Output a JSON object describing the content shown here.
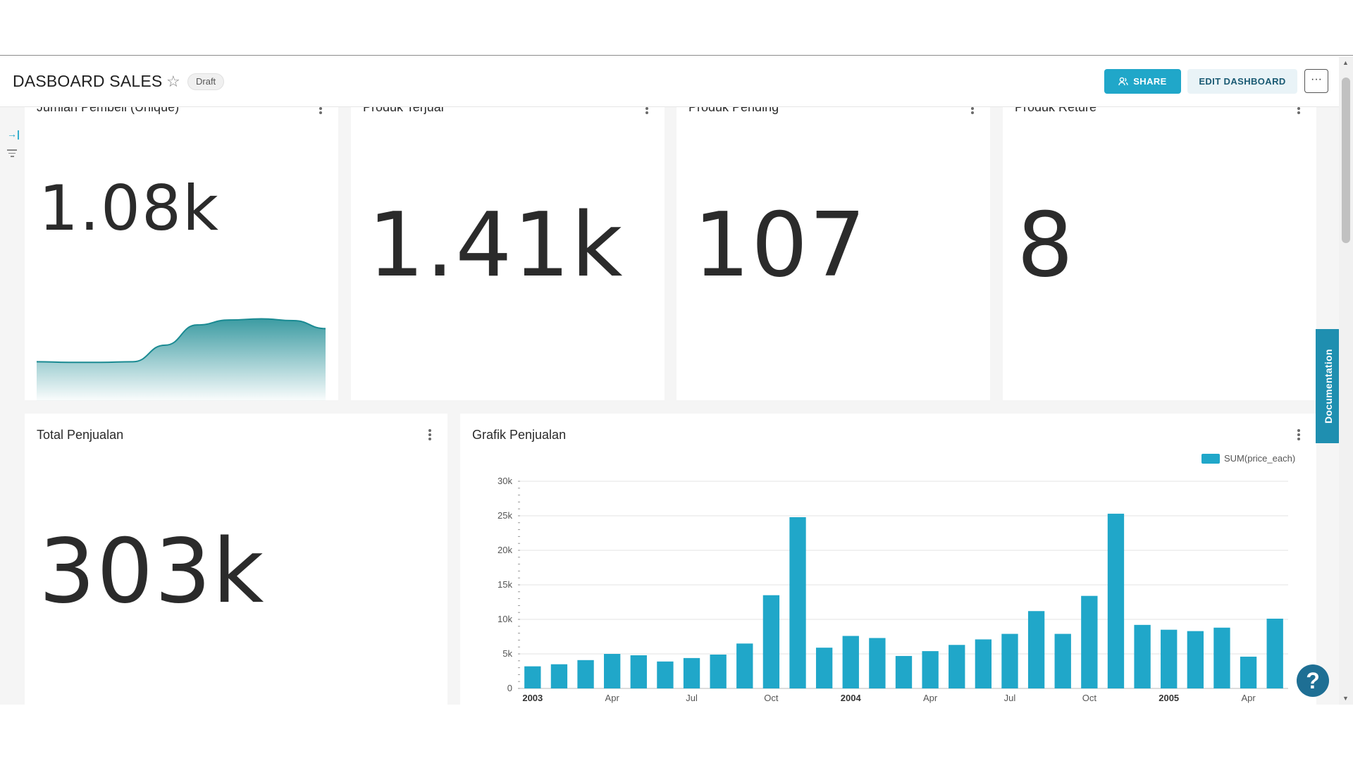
{
  "header": {
    "title": "DASBOARD SALES",
    "draft_label": "Draft",
    "share_label": "SHARE",
    "edit_label": "EDIT DASHBOARD",
    "more_label": "···"
  },
  "cards": {
    "unique_buyers": {
      "title": "Jumlah Pembeli (Unique)",
      "value": "1.08k"
    },
    "sold": {
      "title": "Produk Terjual",
      "value": "1.41k"
    },
    "pending": {
      "title": "Produk Pending",
      "value": "107"
    },
    "returned": {
      "title": "Produk Reture",
      "value": "8"
    },
    "total_sales": {
      "title": "Total Penjualan",
      "value": "303k"
    },
    "sales_chart": {
      "title": "Grafik Penjualan"
    }
  },
  "documentation_tab": "Documentation",
  "help_label": "?",
  "colors": {
    "accent": "#20a7c9",
    "bar": "#20a7c9",
    "sparkline": "#1a8a92"
  },
  "chart_data": {
    "type": "bar",
    "title": "Grafik Penjualan",
    "legend": [
      "SUM(price_each)"
    ],
    "legend_position": "top-right",
    "ylim": [
      0,
      30000
    ],
    "yticks": [
      "0",
      "5k",
      "10k",
      "15k",
      "20k",
      "25k",
      "30k"
    ],
    "xtick_labels": [
      {
        "index": 0,
        "label": "2003",
        "bold": true
      },
      {
        "index": 3,
        "label": "Apr",
        "bold": false
      },
      {
        "index": 6,
        "label": "Jul",
        "bold": false
      },
      {
        "index": 9,
        "label": "Oct",
        "bold": false
      },
      {
        "index": 12,
        "label": "2004",
        "bold": true
      },
      {
        "index": 15,
        "label": "Apr",
        "bold": false
      },
      {
        "index": 18,
        "label": "Jul",
        "bold": false
      },
      {
        "index": 21,
        "label": "Oct",
        "bold": false
      },
      {
        "index": 24,
        "label": "2005",
        "bold": true
      },
      {
        "index": 27,
        "label": "Apr",
        "bold": false
      }
    ],
    "categories": [
      "2003-01",
      "2003-02",
      "2003-03",
      "2003-04",
      "2003-05",
      "2003-06",
      "2003-07",
      "2003-08",
      "2003-09",
      "2003-10",
      "2003-11",
      "2003-12",
      "2004-01",
      "2004-02",
      "2004-03",
      "2004-04",
      "2004-05",
      "2004-06",
      "2004-07",
      "2004-08",
      "2004-09",
      "2004-10",
      "2004-11",
      "2004-12",
      "2005-01",
      "2005-02",
      "2005-03",
      "2005-04",
      "2005-05"
    ],
    "series": [
      {
        "name": "SUM(price_each)",
        "values": [
          3200,
          3500,
          4100,
          5000,
          4800,
          3900,
          4400,
          4900,
          6500,
          13500,
          24800,
          5900,
          7600,
          7300,
          4700,
          5400,
          6300,
          7100,
          7900,
          11200,
          7900,
          13400,
          25300,
          9200,
          8500,
          8300,
          8800,
          4600,
          10100
        ]
      }
    ],
    "grid": true
  },
  "sparkline_data": {
    "type": "area",
    "values": [
      0.18,
      0.17,
      0.17,
      0.18,
      0.45,
      0.78,
      0.86,
      0.88,
      0.85,
      0.72
    ]
  }
}
